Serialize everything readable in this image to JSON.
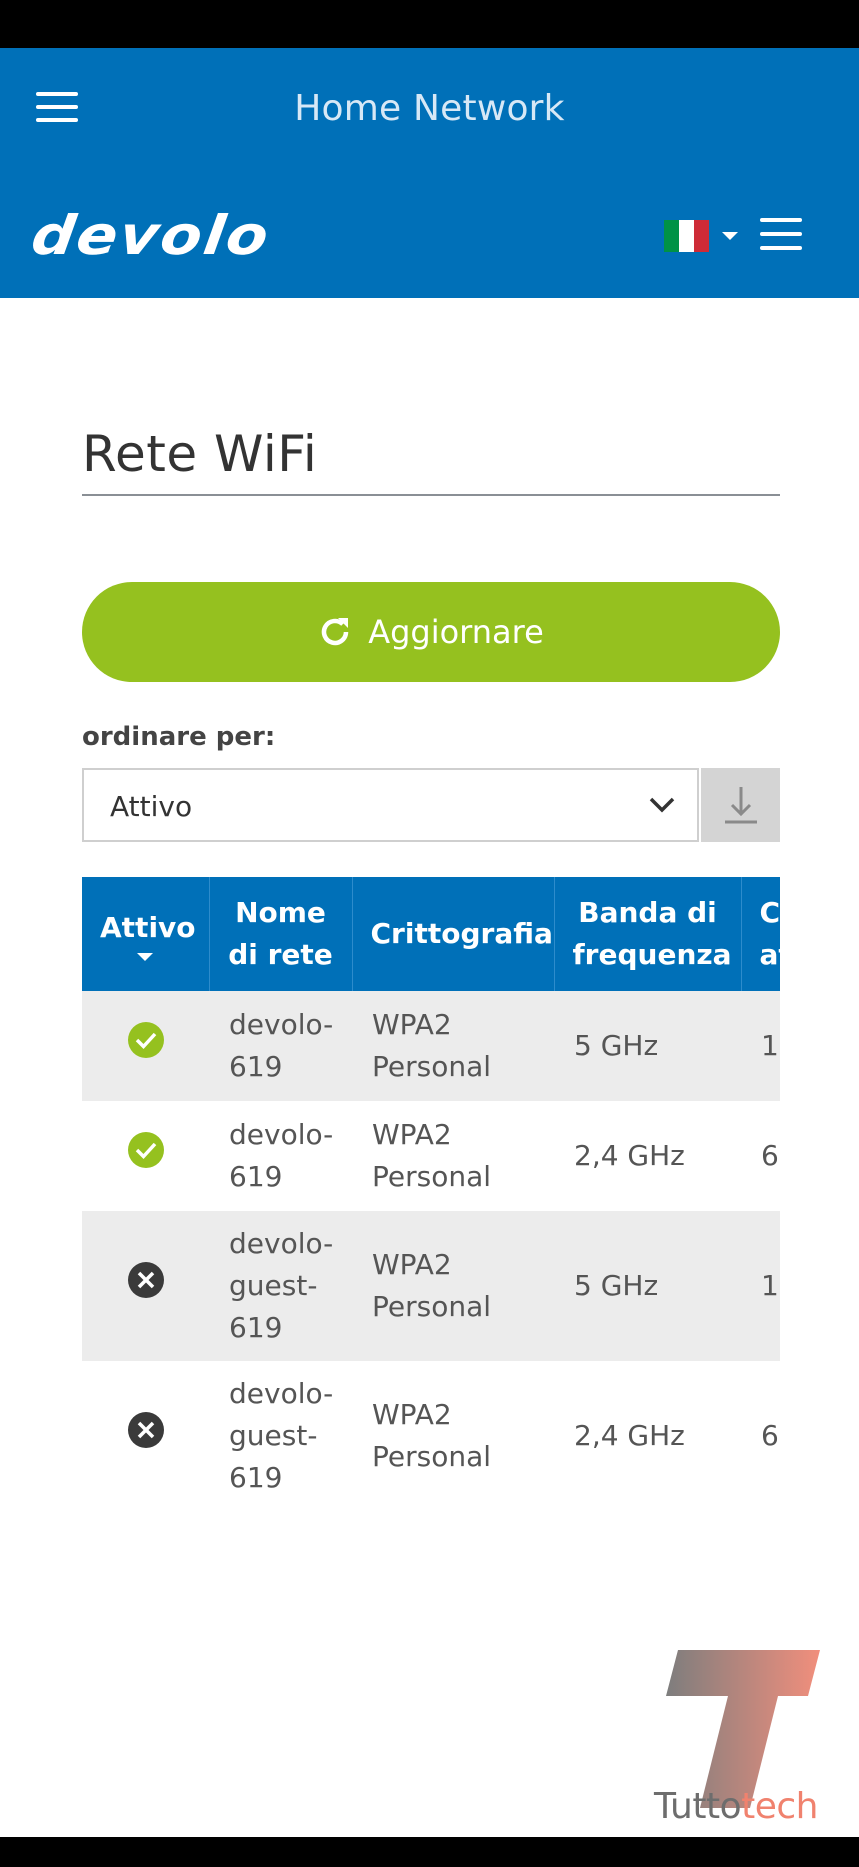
{
  "header": {
    "title": "Home Network",
    "logo_text": "devolo",
    "flag_colors": [
      "#009246",
      "#ffffff",
      "#ce2b37"
    ]
  },
  "main": {
    "title": "Rete WiFi",
    "refresh_label": "Aggiornare",
    "sort": {
      "label": "ordinare per:",
      "selected": "Attivo"
    }
  },
  "table": {
    "headers": [
      "Attivo",
      "Nome di rete",
      "Crittografia",
      "Banda di frequenza",
      "Canale attuale"
    ],
    "rows": [
      {
        "active": true,
        "status_icon": "check-circle-icon",
        "name": "devolo-619",
        "encryption": "WPA2 Personal",
        "band": "5 GHz",
        "channel": "1"
      },
      {
        "active": true,
        "status_icon": "check-circle-icon",
        "name": "devolo-619",
        "encryption": "WPA2 Personal",
        "band": "2,4 GHz",
        "channel": "6"
      },
      {
        "active": false,
        "status_icon": "x-circle-icon",
        "name": "devolo-guest-619",
        "encryption": "WPA2 Personal",
        "band": "5 GHz",
        "channel": "1"
      },
      {
        "active": false,
        "status_icon": "x-circle-icon",
        "name": "devolo-guest-619",
        "encryption": "WPA2 Personal",
        "band": "2,4 GHz",
        "channel": "6"
      }
    ]
  },
  "watermark": {
    "text_a": "Tutto",
    "text_b": "tech"
  },
  "colors": {
    "brand_blue": "#0070b8",
    "accent_green": "#95c11f",
    "active_green": "#95c11f",
    "inactive_dark": "#3a3a3a"
  }
}
